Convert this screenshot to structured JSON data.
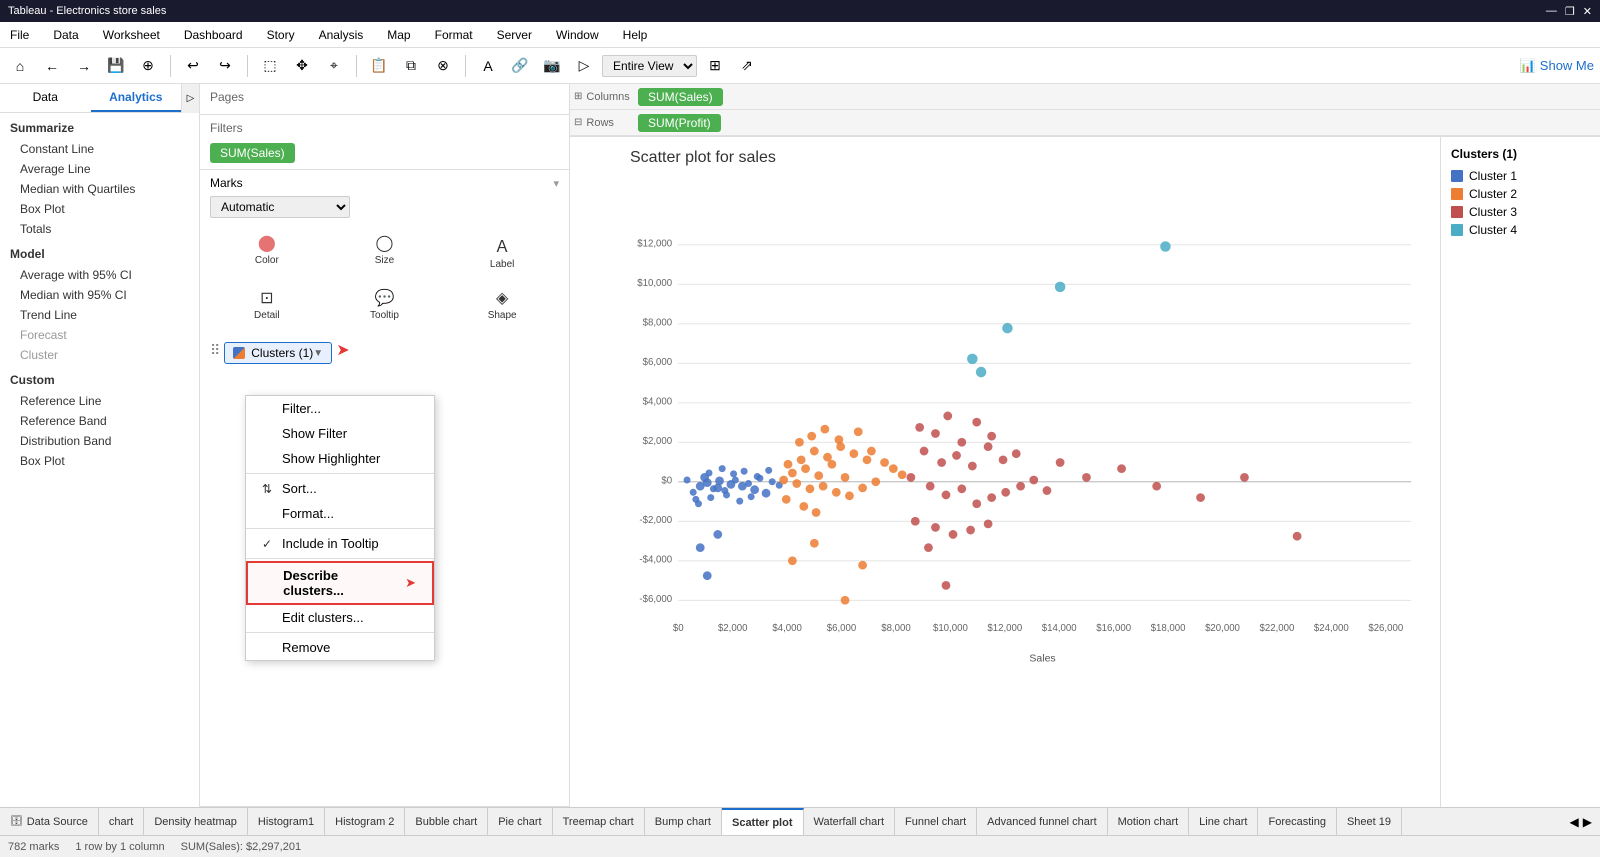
{
  "titleBar": {
    "title": "Tableau - Electronics store sales",
    "controls": [
      "—",
      "❐",
      "✕"
    ]
  },
  "menuBar": {
    "items": [
      "File",
      "Data",
      "Worksheet",
      "Dashboard",
      "Story",
      "Analysis",
      "Map",
      "Format",
      "Server",
      "Window",
      "Help"
    ]
  },
  "toolbar": {
    "showMeLabel": "Show Me"
  },
  "panels": {
    "left": {
      "tabs": [
        "Data",
        "Analytics"
      ],
      "activeTab": "Analytics",
      "sections": {
        "summarize": {
          "label": "Summarize",
          "items": [
            "Constant Line",
            "Average Line",
            "Median with Quartiles",
            "Box Plot",
            "Totals"
          ]
        },
        "model": {
          "label": "Model",
          "items": [
            "Average with 95% CI",
            "Median with 95% CI",
            "Trend Line",
            "Forecast",
            "Cluster"
          ]
        },
        "custom": {
          "label": "Custom",
          "items": [
            "Reference Line",
            "Reference Band",
            "Distribution Band",
            "Box Plot"
          ]
        }
      }
    }
  },
  "pages": {
    "label": "Pages"
  },
  "filters": {
    "label": "Filters",
    "pills": [
      "SUM(Sales)"
    ]
  },
  "marks": {
    "label": "Marks",
    "type": "Automatic",
    "buttons": [
      {
        "icon": "⬤⬤",
        "label": "Color"
      },
      {
        "icon": "◯",
        "label": "Size"
      },
      {
        "icon": "A",
        "label": "Label"
      },
      {
        "icon": "□",
        "label": "Detail"
      },
      {
        "icon": "💬",
        "label": "Tooltip"
      },
      {
        "icon": "◈",
        "label": "Shape"
      }
    ],
    "clusterPill": {
      "label": "Clusters (1)",
      "hasDropdown": true
    }
  },
  "contextMenu": {
    "items": [
      {
        "id": "filter",
        "label": "Filter...",
        "check": ""
      },
      {
        "id": "show-filter",
        "label": "Show Filter",
        "check": ""
      },
      {
        "id": "show-highlighter",
        "label": "Show Highlighter",
        "check": ""
      },
      {
        "id": "sort",
        "label": "Sort...",
        "check": ""
      },
      {
        "id": "format",
        "label": "Format...",
        "check": ""
      },
      {
        "id": "include-tooltip",
        "label": "Include in Tooltip",
        "check": "✓"
      },
      {
        "id": "describe-clusters",
        "label": "Describe clusters...",
        "check": "",
        "highlighted": true
      },
      {
        "id": "edit-clusters",
        "label": "Edit clusters...",
        "check": ""
      },
      {
        "id": "remove",
        "label": "Remove",
        "check": ""
      }
    ]
  },
  "shelf": {
    "columns": {
      "label": "Columns",
      "pill": "SUM(Sales)"
    },
    "rows": {
      "label": "Rows",
      "pill": "SUM(Profit)"
    }
  },
  "chart": {
    "title": "Scatter plot for sales",
    "xAxisLabel": "Sales",
    "yAxisValues": [
      "$12,000",
      "$10,000",
      "$8,000",
      "$6,000",
      "$4,000",
      "$2,000",
      "$0",
      "-$2,000",
      "-$4,000",
      "-$6,000"
    ],
    "xAxisValues": [
      "$0",
      "$2,000",
      "$4,000",
      "$6,000",
      "$8,000",
      "$10,000",
      "$12,000",
      "$14,000",
      "$16,000",
      "$18,000",
      "$20,000",
      "$22,000",
      "$24,000",
      "$26,000"
    ]
  },
  "legend": {
    "title": "Clusters (1)",
    "items": [
      {
        "label": "Cluster 1",
        "color": "#4472c4"
      },
      {
        "label": "Cluster 2",
        "color": "#ed7d31"
      },
      {
        "label": "Cluster 3",
        "color": "#c0504d"
      },
      {
        "label": "Cluster 4",
        "color": "#4bacc6"
      }
    ]
  },
  "bottomTabs": {
    "tabs": [
      {
        "id": "data-source",
        "label": "Data Source",
        "icon": "🗄"
      },
      {
        "id": "chart",
        "label": "chart",
        "icon": ""
      },
      {
        "id": "density-heatmap",
        "label": "Density heatmap",
        "icon": ""
      },
      {
        "id": "histogram1",
        "label": "Histogram1",
        "icon": ""
      },
      {
        "id": "histogram2",
        "label": "Histogram 2",
        "icon": ""
      },
      {
        "id": "bubble-chart",
        "label": "Bubble chart",
        "icon": ""
      },
      {
        "id": "pie-chart",
        "label": "Pie chart",
        "icon": ""
      },
      {
        "id": "treemap-chart",
        "label": "Treemap chart",
        "icon": ""
      },
      {
        "id": "bump-chart",
        "label": "Bump chart",
        "icon": ""
      },
      {
        "id": "scatter-plot",
        "label": "Scatter plot",
        "icon": "",
        "active": true
      },
      {
        "id": "waterfall-chart",
        "label": "Waterfall chart",
        "icon": ""
      },
      {
        "id": "funnel-chart",
        "label": "Funnel chart",
        "icon": ""
      },
      {
        "id": "advanced-funnel",
        "label": "Advanced funnel chart",
        "icon": ""
      },
      {
        "id": "motion-chart",
        "label": "Motion chart",
        "icon": ""
      },
      {
        "id": "line-chart",
        "label": "Line chart",
        "icon": ""
      },
      {
        "id": "forecasting",
        "label": "Forecasting",
        "icon": ""
      },
      {
        "id": "sheet19",
        "label": "Sheet 19",
        "icon": ""
      }
    ]
  },
  "statusBar": {
    "marks": "782 marks",
    "rows": "1 row by 1 column",
    "sum": "SUM(Sales): $2,297,201"
  },
  "colors": {
    "cluster1": "#4472c4",
    "cluster2": "#ed7d31",
    "cluster3": "#c0504d",
    "cluster4": "#4bacc6",
    "pill": "#4caf50",
    "accent": "#1e6fcc"
  }
}
